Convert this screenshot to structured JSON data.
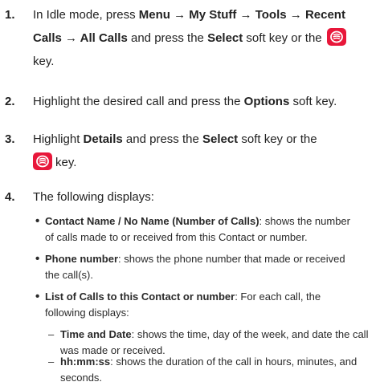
{
  "colors": {
    "key_red": "#e8173a",
    "text": "#222222"
  },
  "icons": {
    "select_key": "select-key-icon"
  },
  "steps": [
    {
      "num": "1.",
      "l1": [
        "In Idle mode, press ",
        "Menu → My Stuff → Tools → Recent"
      ],
      "l2": [
        "Calls → All Calls",
        " and press the ",
        "Select",
        " soft key or the"
      ],
      "l3": "key."
    },
    {
      "num": "2.",
      "parts": [
        "Highlight the desired call and press the ",
        "Options",
        " soft key."
      ]
    },
    {
      "num": "3.",
      "l1": [
        "Highlight ",
        "Details",
        " and press the ",
        "Select",
        " soft key or the"
      ],
      "l2": "key."
    },
    {
      "num": "4.",
      "text": "The following displays:"
    }
  ],
  "bullets": [
    {
      "mark": "•",
      "term": "Contact Name / No Name (Number of Calls)",
      "l1": ": shows the number",
      "l2": "of calls made to or received from this Contact or number."
    },
    {
      "mark": "•",
      "term": "Phone number",
      "l1": ": shows the phone number that made or received",
      "l2": "the call(s)."
    },
    {
      "mark": "•",
      "term": "List of Calls to this Contact or number",
      "l1": ": For each call, the",
      "l2": "following displays:"
    }
  ],
  "subbullets": [
    {
      "mark": "–",
      "term": "Time and Date",
      "l1": ": shows the time, day of the week, and date the call",
      "l2": "was made or received."
    },
    {
      "mark": "–",
      "term": "hh:mm:ss",
      "l1": ": shows the duration of the call in hours, minutes, and",
      "l2": "seconds."
    }
  ]
}
